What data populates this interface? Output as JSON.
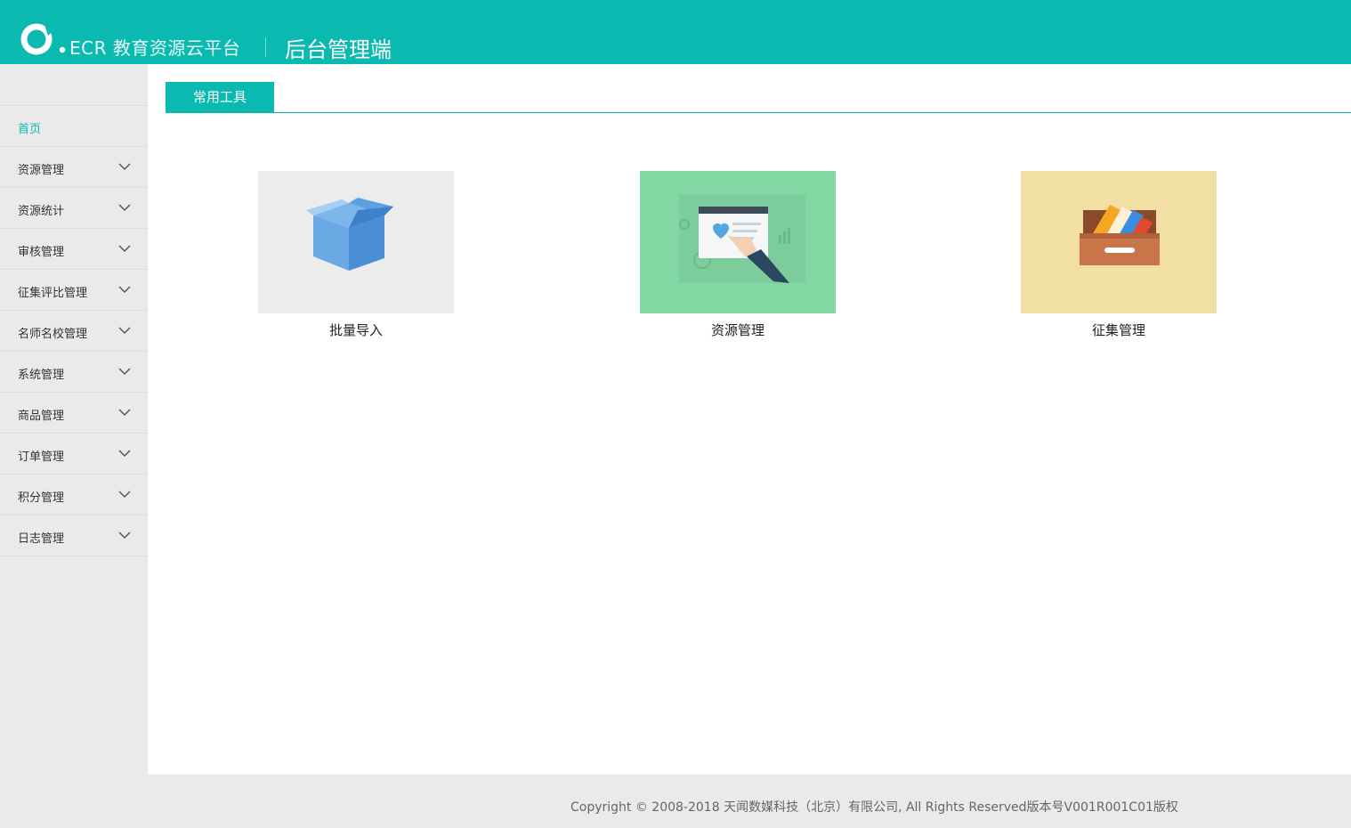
{
  "header": {
    "logo_text": "ECR 教育资源云平台",
    "title": "后台管理端",
    "logo_icon": "ecr-logo-icon",
    "color": "#0ab9af"
  },
  "sidebar": {
    "items": [
      {
        "label": "首页",
        "active": true
      },
      {
        "label": "资源管理",
        "icon": "chevron-down-icon"
      },
      {
        "label": "资源统计",
        "icon": "chevron-down-icon"
      },
      {
        "label": "审核管理",
        "icon": "chevron-down-icon"
      },
      {
        "label": "征集评比管理",
        "icon": "chevron-down-icon"
      },
      {
        "label": "名师名校管理",
        "icon": "chevron-down-icon"
      },
      {
        "label": "系统管理",
        "icon": "chevron-down-icon"
      },
      {
        "label": "商品管理",
        "icon": "chevron-down-icon"
      },
      {
        "label": "订单管理",
        "icon": "chevron-down-icon"
      },
      {
        "label": "积分管理",
        "icon": "chevron-down-icon"
      },
      {
        "label": "日志管理",
        "icon": "chevron-down-icon"
      }
    ]
  },
  "main": {
    "tab_label": "常用工具",
    "tools": [
      {
        "label": "批量导入",
        "icon": "box-icon",
        "bg": "#ececec"
      },
      {
        "label": "资源管理",
        "icon": "browser-touch-icon",
        "bg": "#82d8a3"
      },
      {
        "label": "征集管理",
        "icon": "drawer-icon",
        "bg": "#f2dfa4"
      }
    ]
  },
  "footer": {
    "copyright": "Copyright © 2008-2018 天闻数媒科技（北京）有限公司, All Rights Reserved版本号V001R001C01版权"
  }
}
